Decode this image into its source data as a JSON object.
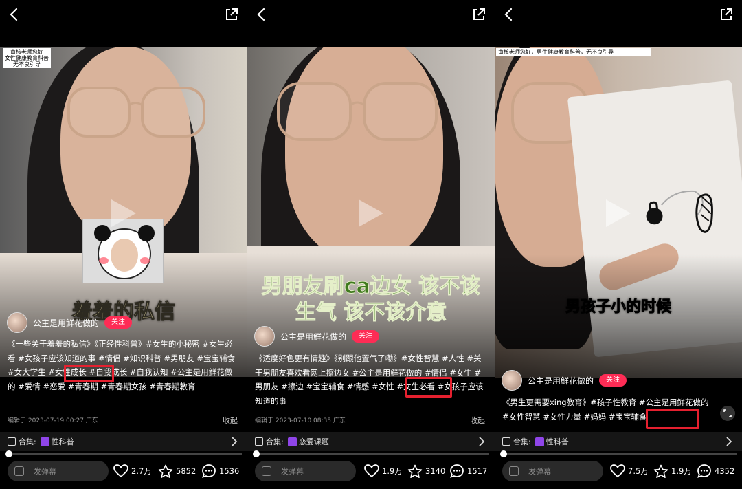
{
  "panels": [
    {
      "review_note": [
        "审核老师您好",
        "女性健康教育科普",
        "无不良引导"
      ],
      "caption": "羞羞的私信",
      "author": "公主是用鲜花做的",
      "follow_label": "关注",
      "description": "《一些关于羞羞的私信》《正经性科普》#女生的小秘密 #女生必看 #女孩子应该知道的事 #情侣 #知识科普 #男朋友 #宝宝辅食 #女大学生 #女性成长 #自我成长 #自我认知 #公主是用鲜花做的 #爱情 #恋爱 #青春期 #青春期女孩 #青春期教育",
      "edit_time": "编辑于  2023-07-19 00:27 广东",
      "collapse_label": "收起",
      "collection_prefix": "合集:",
      "collection_name": "性科普",
      "danmaku_placeholder": "发弹幕",
      "likes": "2.7万",
      "favorites": "5852",
      "comments": "1536"
    },
    {
      "caption": "男朋友刷ca边女 该不该生气 该不该介意",
      "author": "公主是用鲜花做的",
      "follow_label": "关注",
      "description": "《适度好色更有情趣》《别跟他置气了嘞》#女性智慧 #人性 #关于男朋友喜欢看网上擦边女 #公主是用鲜花做的 #情侣 #女生 #男朋友 #擦边 #宝宝辅食 #情感 #女性 #女生必看 #女孩子应该知道的事",
      "edit_time": "编辑于  2023-07-10 08:35 广东",
      "collapse_label": "收起",
      "collection_prefix": "合集:",
      "collection_name": "恋爱课题",
      "danmaku_placeholder": "发弹幕",
      "likes": "1.9万",
      "favorites": "3140",
      "comments": "1517"
    },
    {
      "review_note": [
        "审核老师您好，男生健康教育科普，无不良引导"
      ],
      "caption": "男孩子小的时候",
      "author": "公主是用鲜花做的",
      "follow_label": "关注",
      "description": "《男生更需要xing教育》#孩子性教育 #公主是用鲜花做的 #女性智慧 #女性力量 #妈妈 #宝宝辅食",
      "collection_prefix": "合集:",
      "collection_name": "性科普",
      "danmaku_placeholder": "发弹幕",
      "likes": "7.5万",
      "favorites": "1.9万",
      "comments": "4352"
    }
  ],
  "colors": {
    "follow": "#fe2c55",
    "highlight_box": "#e5202f",
    "collection_badge": "#8f45e8"
  }
}
